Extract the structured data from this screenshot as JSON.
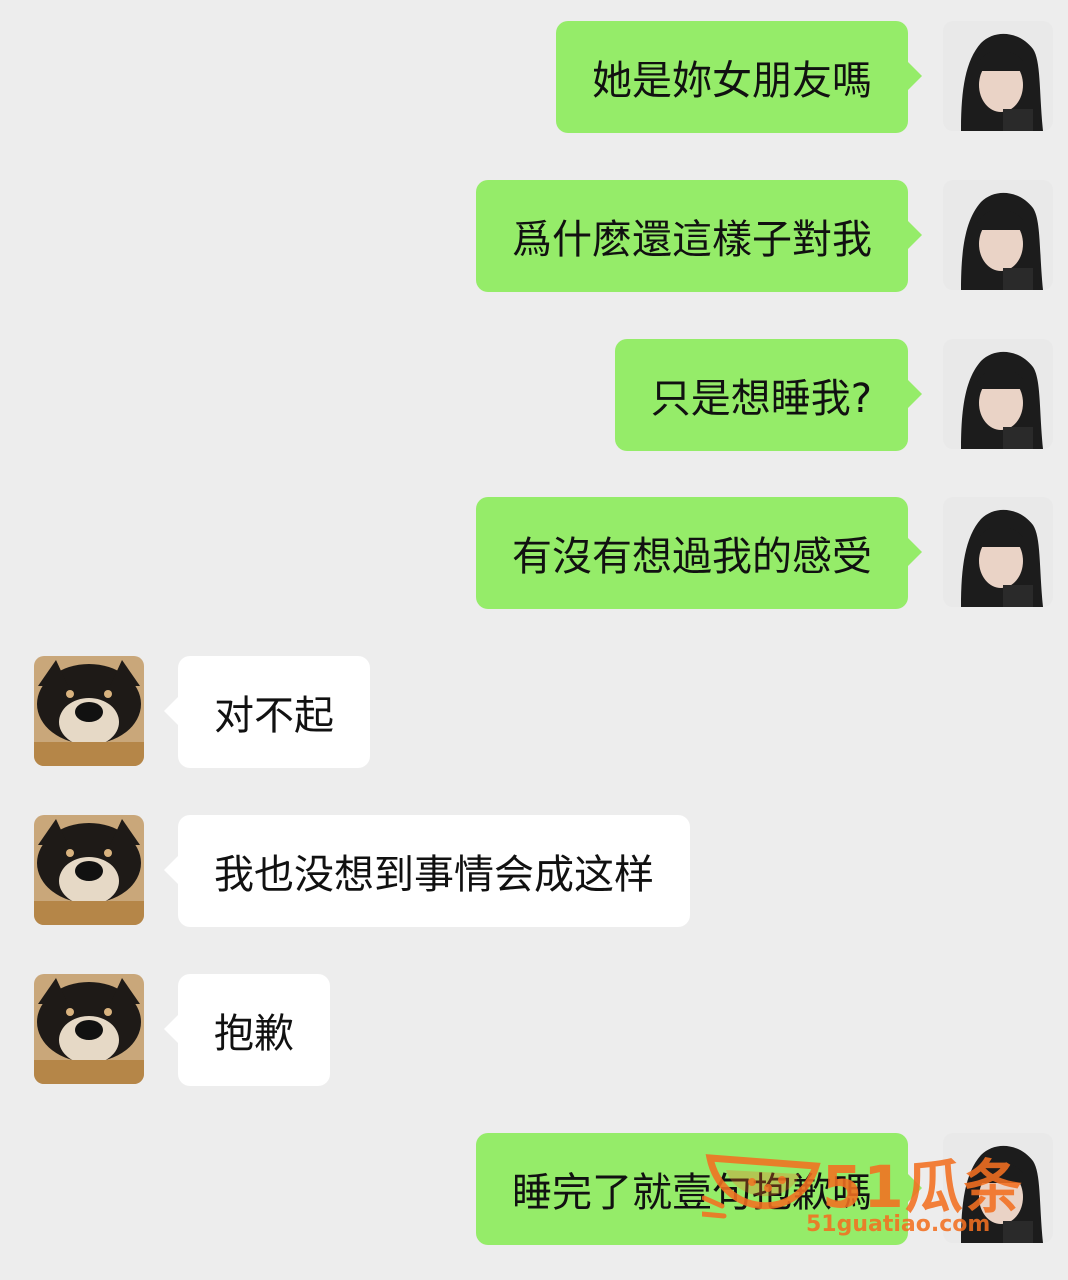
{
  "messages": [
    {
      "side": "me",
      "text": "她是妳女朋友嗎"
    },
    {
      "side": "me",
      "text": "爲什麽還這樣子對我"
    },
    {
      "side": "me",
      "text": "只是想睡我?"
    },
    {
      "side": "me",
      "text": "有沒有想過我的感受"
    },
    {
      "side": "them",
      "text": "对不起"
    },
    {
      "side": "them",
      "text": "我也没想到事情会成这样"
    },
    {
      "side": "them",
      "text": "抱歉"
    },
    {
      "side": "me",
      "text": "睡完了就壹句抱歉嗎"
    }
  ],
  "avatars": {
    "me": "girl-portrait-avatar",
    "them": "shiba-dog-avatar"
  },
  "watermark": {
    "brand": "51瓜条",
    "url": "51guatiao.com",
    "icon": "watermelon-slice-icon"
  },
  "colors": {
    "background": "#ededed",
    "outgoing_bubble": "#95ec69",
    "incoming_bubble": "#ffffff",
    "watermark": "#f37021"
  }
}
